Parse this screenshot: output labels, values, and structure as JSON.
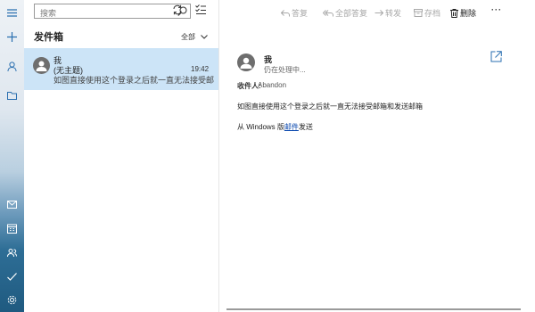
{
  "search": {
    "placeholder": "搜索"
  },
  "folder": {
    "title": "发件箱",
    "filter_label": "全部"
  },
  "messages": [
    {
      "from": "我",
      "subject": "(无主题)",
      "preview": "如图直接使用这个登录之后就一直无法接受邮件",
      "time": "19:42"
    }
  ],
  "toolbar": {
    "reply": "答复",
    "reply_all": "全部答复",
    "forward": "转发",
    "archive": "存档",
    "delete": "删除",
    "more": "···"
  },
  "reader": {
    "from": "我",
    "status": "仍在处理中...",
    "to_label": "收件人:",
    "to_value": "Abandon",
    "body": "如图直接使用这个登录之后就一直无法接受邮箱和发送邮箱",
    "signature_prefix": "从 Windows 版",
    "signature_link": "邮件",
    "signature_suffix": "发送"
  },
  "colors": {
    "accent": "#0078d4",
    "selected": "#cce4f7",
    "link": "#0645ad"
  },
  "icons": [
    "hamburger-icon",
    "compose-icon",
    "person-icon",
    "folder-icon",
    "mail-icon",
    "calendar-icon",
    "people-icon",
    "todo-icon",
    "settings-icon",
    "search-icon",
    "sync-icon",
    "select-icon",
    "chevron-down-icon",
    "avatar-icon",
    "popout-icon",
    "reply-icon",
    "reply-all-icon",
    "forward-icon",
    "archive-icon",
    "trash-icon"
  ]
}
